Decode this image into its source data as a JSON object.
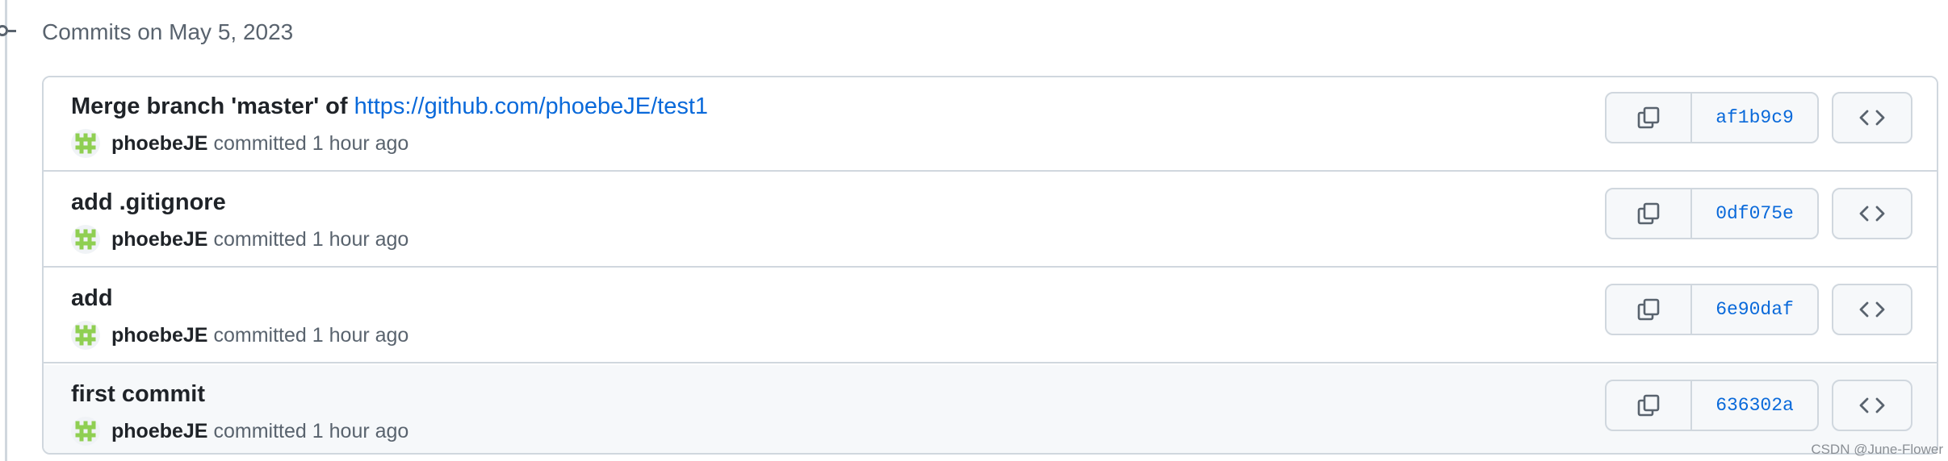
{
  "timeline": {
    "icon": "git-commit-icon",
    "heading": "Commits on May 5, 2023"
  },
  "commits": [
    {
      "title": "Merge branch 'master' of",
      "title_link": "https://github.com/phoebeJE/test1",
      "author": "phoebeJE",
      "action": "committed",
      "time": "1 hour ago",
      "sha": "af1b9c9",
      "hovered": false
    },
    {
      "title": "add .gitignore",
      "title_link": "",
      "author": "phoebeJE",
      "action": "committed",
      "time": "1 hour ago",
      "sha": "0df075e",
      "hovered": false
    },
    {
      "title": "add",
      "title_link": "",
      "author": "phoebeJE",
      "action": "committed",
      "time": "1 hour ago",
      "sha": "6e90daf",
      "hovered": false
    },
    {
      "title": "first commit",
      "title_link": "",
      "author": "phoebeJE",
      "action": "committed",
      "time": "1 hour ago",
      "sha": "636302a",
      "hovered": true
    }
  ],
  "icons": {
    "copy": "copy-icon",
    "browse": "code-icon",
    "avatar": "identicon-avatar"
  },
  "colors": {
    "link": "#0969da",
    "avatar_identicon": "#8fcf52",
    "border": "#d0d7de",
    "muted_text": "#59636e"
  },
  "watermark": "CSDN @June-Flower"
}
